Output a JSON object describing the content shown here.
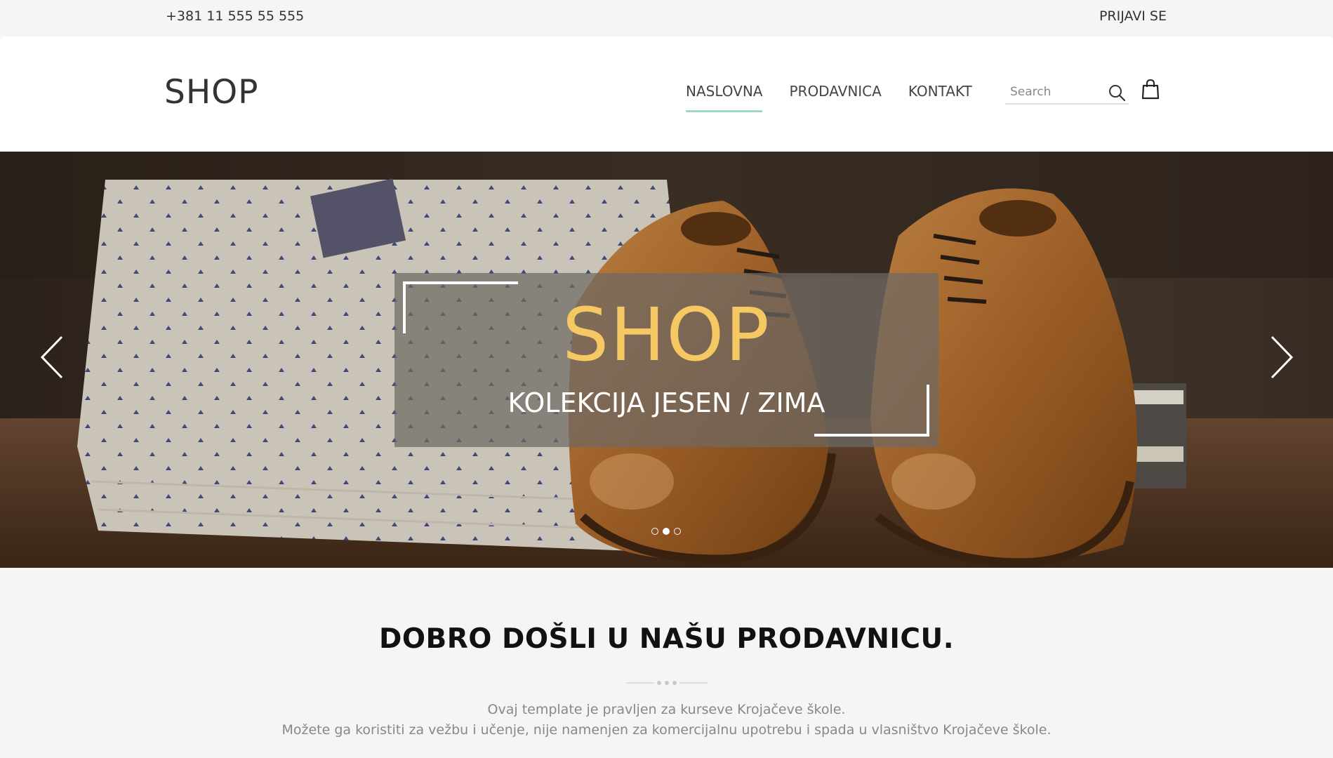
{
  "topbar": {
    "phone": "+381 11 555 55 555",
    "login": "PRIJAVI SE"
  },
  "header": {
    "logo": "SHOP",
    "nav": [
      {
        "label": "NASLOVNA",
        "active": true
      },
      {
        "label": "PRODAVNICA",
        "active": false
      },
      {
        "label": "KONTAKT",
        "active": false
      }
    ],
    "search_placeholder": "Search",
    "icons": {
      "search": "search-icon",
      "cart": "shopping-bag-icon"
    }
  },
  "hero": {
    "title": "SHOP",
    "subtitle": "KOLEKCIJA JESEN / ZIMA",
    "slide_count": 3,
    "active_slide": 2,
    "colors": {
      "title": "#f6c863",
      "accent": "#9fd6c9"
    }
  },
  "intro": {
    "heading": "DOBRO DOŠLI U NAŠU PRODAVNICU.",
    "line1": "Ovaj template je pravljen za kurseve Krojačeve škole.",
    "line2": "Možete ga koristiti za vežbu i učenje, nije namenjen za komercijalnu upotrebu i spada u vlasništvo Krojačeve škole."
  }
}
